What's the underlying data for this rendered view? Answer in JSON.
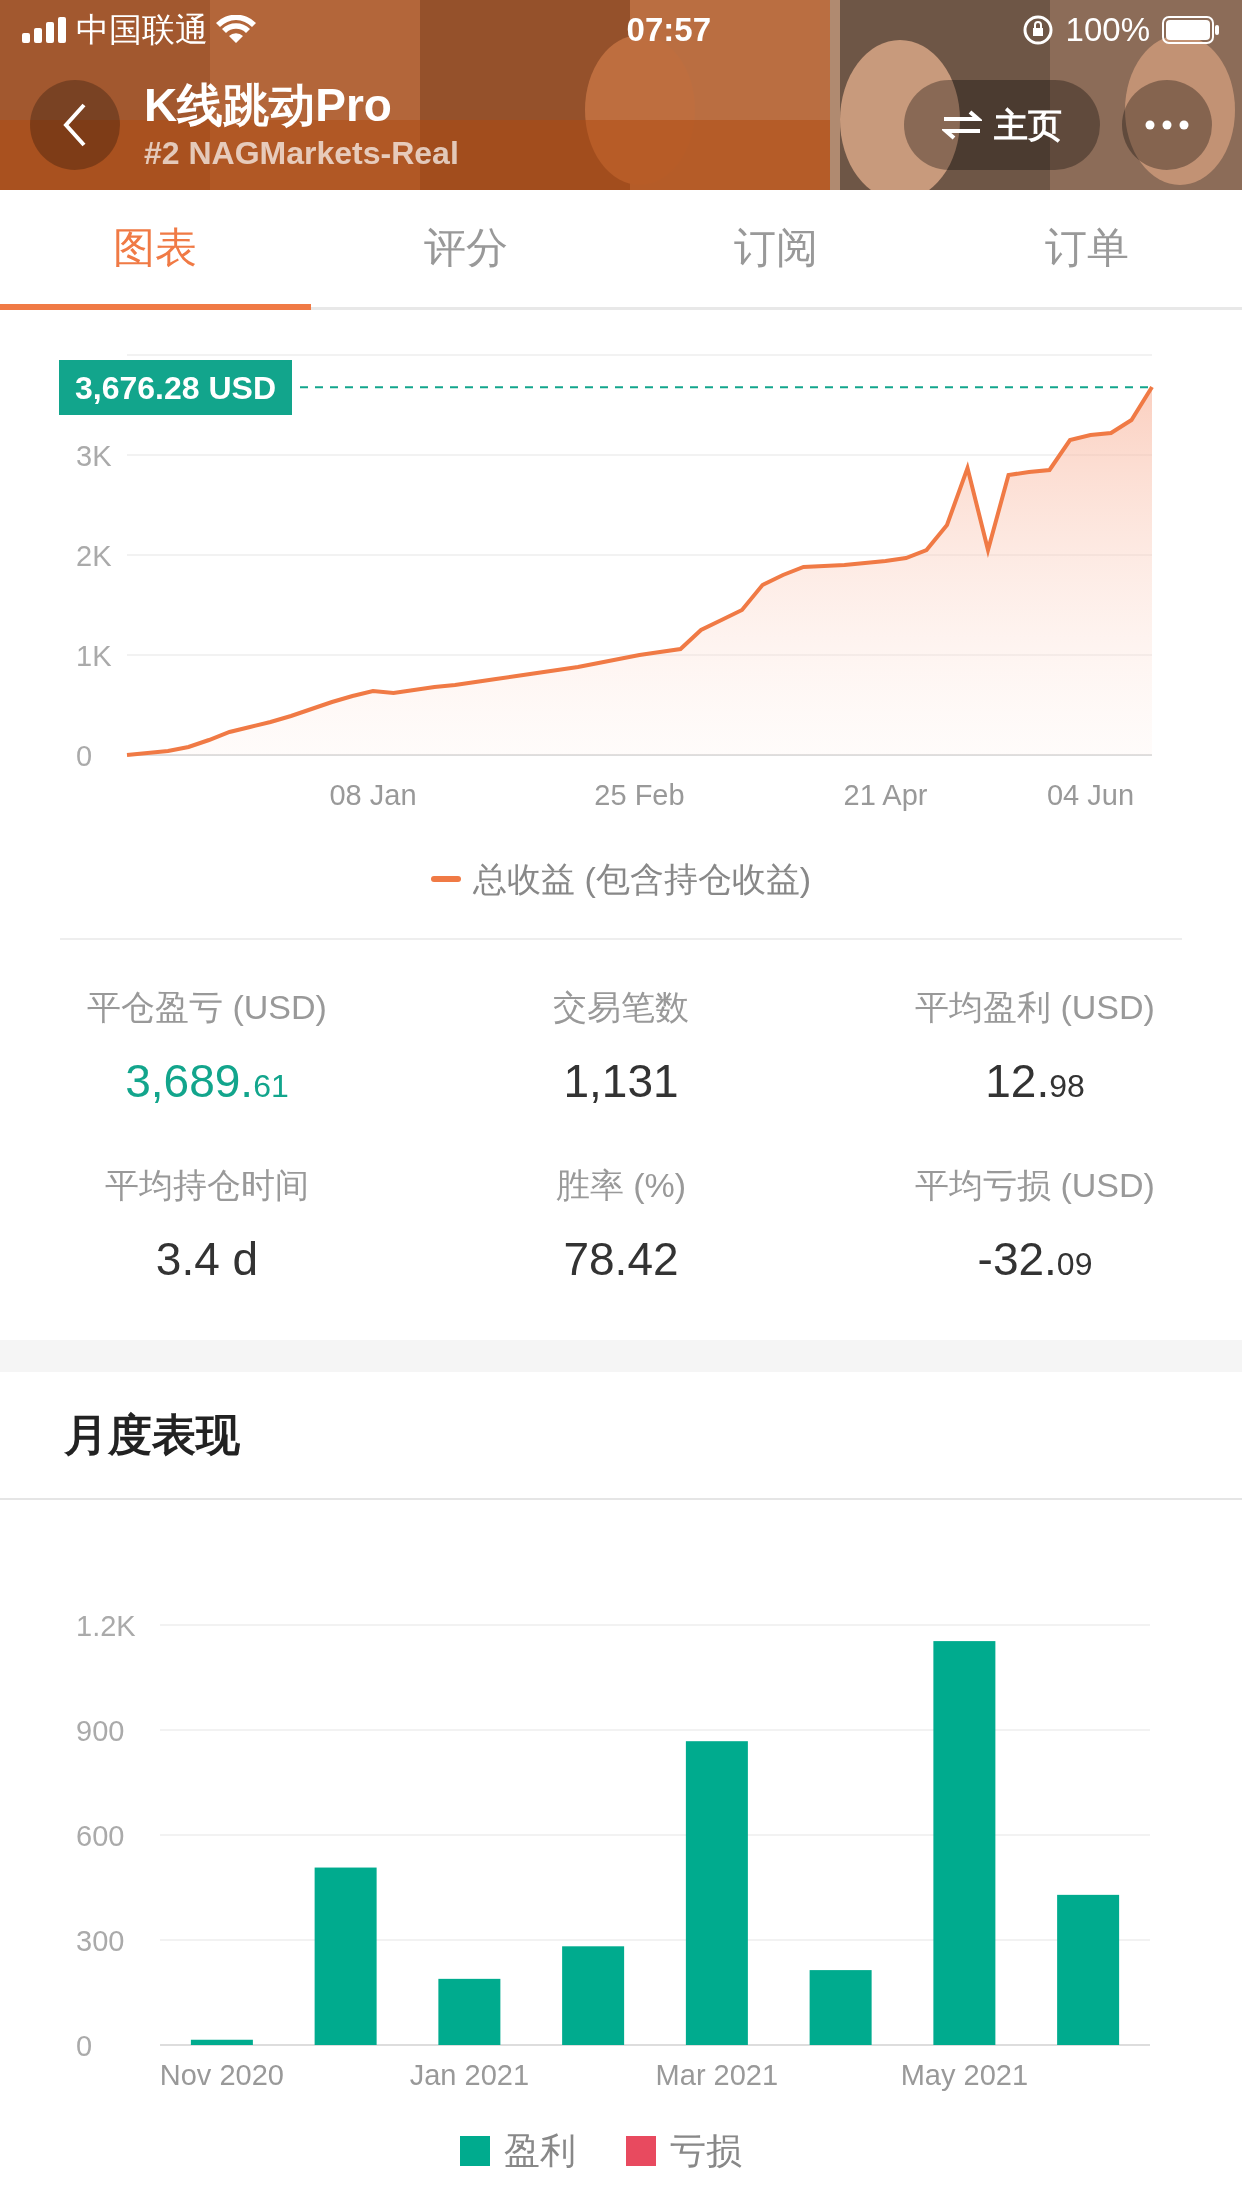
{
  "status_bar": {
    "carrier": "中国联通",
    "time": "07:57",
    "battery": "100%"
  },
  "header": {
    "title": "K线跳动Pro",
    "subtitle": "#2 NAGMarkets-Real",
    "home_button": "主页"
  },
  "tabs": [
    {
      "label": "图表",
      "selected": true
    },
    {
      "label": "评分",
      "selected": false
    },
    {
      "label": "订阅",
      "selected": false
    },
    {
      "label": "订单",
      "selected": false
    }
  ],
  "equity_chart": {
    "chart_data": {
      "type": "area",
      "grid": true,
      "categories": [
        null,
        null,
        null,
        null,
        null,
        null,
        null,
        null,
        null,
        null,
        null,
        null,
        "08 Jan",
        null,
        null,
        null,
        null,
        null,
        null,
        null,
        null,
        null,
        null,
        null,
        null,
        "25 Feb",
        null,
        null,
        null,
        null,
        null,
        null,
        null,
        null,
        null,
        null,
        null,
        "21 Apr",
        null,
        null,
        null,
        null,
        null,
        null,
        null,
        null,
        null,
        "04 Jun",
        null,
        null,
        null
      ],
      "series": [
        {
          "name": "总收益 (包含持仓收益)",
          "color": "#f07a45",
          "values": [
            0,
            20,
            40,
            80,
            150,
            230,
            280,
            330,
            390,
            460,
            530,
            590,
            640,
            620,
            650,
            680,
            700,
            730,
            760,
            790,
            820,
            850,
            880,
            920,
            960,
            1000,
            1030,
            1060,
            1250,
            1350,
            1450,
            1700,
            1800,
            1880,
            1890,
            1900,
            1920,
            1940,
            1970,
            2050,
            2300,
            2870,
            2050,
            2800,
            2830,
            2850,
            3150,
            3200,
            3220,
            3350,
            3680
          ]
        }
      ],
      "ylim": [
        0,
        4000
      ],
      "ref_lines": [
        {
          "axis": "y",
          "value": 3676.28,
          "label": "3,676.28 USD",
          "color": "#12a58c"
        }
      ],
      "yticks": [
        {
          "value": 0,
          "label": "0"
        },
        {
          "value": 1000,
          "label": "1K"
        },
        {
          "value": 2000,
          "label": "2K"
        },
        {
          "value": 3000,
          "label": "3K"
        }
      ]
    }
  },
  "stats": [
    {
      "label": "平仓盈亏 (USD)",
      "main": "3,689.",
      "small": "61",
      "color": "#12a58c"
    },
    {
      "label": "交易笔数",
      "main": "1,131",
      "color": "#333333"
    },
    {
      "label": "平均盈利 (USD)",
      "main": "12.",
      "small": "98",
      "color": "#333333"
    },
    {
      "label": "平均持仓时间",
      "main": "3.4 d",
      "color": "#333333"
    },
    {
      "label": "胜率 (%)",
      "main": "78.42",
      "color": "#333333"
    },
    {
      "label": "平均亏损 (USD)",
      "main": "-32.",
      "small": "09",
      "color": "#333333"
    }
  ],
  "monthly": {
    "title": "月度表现",
    "chart_data": {
      "type": "bar",
      "grid": true,
      "categories": [
        "Nov 2020",
        null,
        "Jan 2021",
        null,
        "Mar 2021",
        null,
        "May 2021",
        null
      ],
      "series": [
        {
          "name": "盈利",
          "color": "#00ab8e",
          "values": [
            15,
            507,
            189,
            282,
            868,
            214,
            1154,
            429
          ]
        },
        {
          "name": "亏损",
          "color": "#e84a5f",
          "values": [
            0,
            0,
            0,
            0,
            0,
            0,
            0,
            0
          ]
        }
      ],
      "ylim": [
        0,
        1200
      ],
      "yticks": [
        {
          "value": 0,
          "label": "0"
        },
        {
          "value": 300,
          "label": "300"
        },
        {
          "value": 600,
          "label": "600"
        },
        {
          "value": 900,
          "label": "900"
        },
        {
          "value": 1200,
          "label": "1.2K"
        }
      ]
    }
  }
}
